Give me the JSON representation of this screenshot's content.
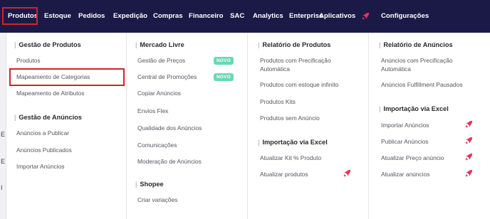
{
  "nav": {
    "items": [
      "Produtos",
      "Estoque",
      "Pedidos",
      "Expedição",
      "Compras",
      "Financeiro",
      "SAC",
      "Analytics",
      "Enterprise",
      "Aplicativos",
      "Configurações"
    ]
  },
  "colors": {
    "nav_bg": "#1b1a47",
    "accent": "#e8305a",
    "badge": "#67d9b4",
    "highlight": "#d1232a"
  },
  "left_strip": [
    "E",
    "E",
    "I"
  ],
  "col1": {
    "gestao_produtos": {
      "title": "Gestão de Produtos",
      "items": [
        "Produtos",
        "Mapeamento de Categorias",
        "Mapeamento de Atributos"
      ]
    },
    "gestao_anuncios": {
      "title": "Gestão de Anúncios",
      "items": [
        "Anúncios a Publicar",
        "Anúncios Publicados",
        "Importar Anúncios"
      ]
    }
  },
  "col2": {
    "mercado_livre": {
      "title": "Mercado Livre",
      "items": [
        "Gestão de Preços",
        "Central de Promoções",
        "Copiar Anúncios",
        "Envios Flex",
        "Qualidade dos Anúncios",
        "Comunicações",
        "Moderação de Anúncios"
      ],
      "badge": "NOVO"
    },
    "shopee": {
      "title": "Shopee",
      "items": [
        "Criar variações"
      ]
    }
  },
  "col3": {
    "relatorio_produtos": {
      "title": "Relatório de Produtos",
      "items": [
        "Produtos com Precificação Automática",
        "Produtos com estoque infinito",
        "Produtos Kits",
        "Produtos sem Anúncio"
      ]
    },
    "importacao": {
      "title": "Importação via Excel",
      "items": [
        "Atualizar Kit % Produto",
        "Atualizar produtos"
      ]
    }
  },
  "col4": {
    "relatorio_anuncios": {
      "title": "Relatório de Anúncios",
      "items": [
        "Anúncios com Precificação Automática",
        "Anúncios Fulfillment Pausados"
      ]
    },
    "importacao": {
      "title": "Importação via Excel",
      "items": [
        "Importar Anúncios",
        "Publicar Anúncios",
        "Atualizar Preço anúncio",
        "Atualizar anúncios"
      ]
    }
  },
  "icons": {
    "rocket": "rocket-icon"
  }
}
